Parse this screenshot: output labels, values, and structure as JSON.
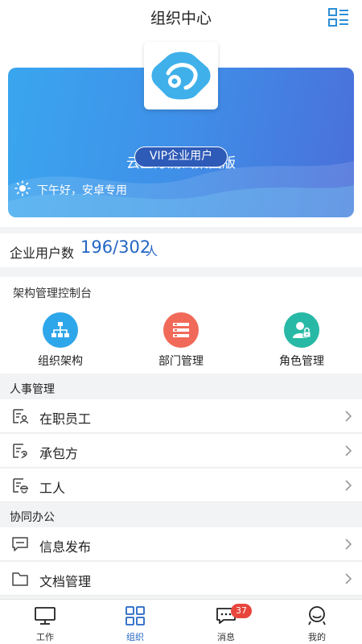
{
  "header": {
    "title": "组织中心",
    "qr_icon": "qr-code-icon"
  },
  "hero": {
    "company_name": "云立方测试集团版",
    "badge": "VIP企业用户",
    "greeting": "下午好，安卓专用",
    "colors": {
      "gradient_start": "#3aa6ef",
      "gradient_end": "#4a6fd9",
      "logo": "#3fb0ea"
    }
  },
  "user_count": {
    "label": "企业用户数",
    "value": "196/302",
    "unit": "人"
  },
  "console": {
    "title": "架构管理控制台",
    "tiles": [
      {
        "label": "组织架构",
        "icon": "org-chart-icon",
        "color": "#2ea6ea"
      },
      {
        "label": "部门管理",
        "icon": "department-list-icon",
        "color": "#f16a59"
      },
      {
        "label": "角色管理",
        "icon": "role-lock-icon",
        "color": "#27b9a5"
      }
    ]
  },
  "hr": {
    "title": "人事管理",
    "items": [
      {
        "label": "在职员工",
        "icon": "employee-card-icon"
      },
      {
        "label": "承包方",
        "icon": "contractor-card-icon"
      },
      {
        "label": "工人",
        "icon": "worker-card-icon"
      }
    ]
  },
  "office": {
    "title": "协同办公",
    "items": [
      {
        "label": "信息发布",
        "icon": "message-publish-icon"
      },
      {
        "label": "文档管理",
        "icon": "folder-icon"
      }
    ]
  },
  "tabbar": {
    "tabs": [
      {
        "label": "工作",
        "icon": "monitor-icon"
      },
      {
        "label": "组织",
        "icon": "grid-icon",
        "active": true
      },
      {
        "label": "消息",
        "icon": "chat-bubble-icon",
        "badge": "37"
      },
      {
        "label": "我的",
        "icon": "profile-icon"
      }
    ]
  }
}
